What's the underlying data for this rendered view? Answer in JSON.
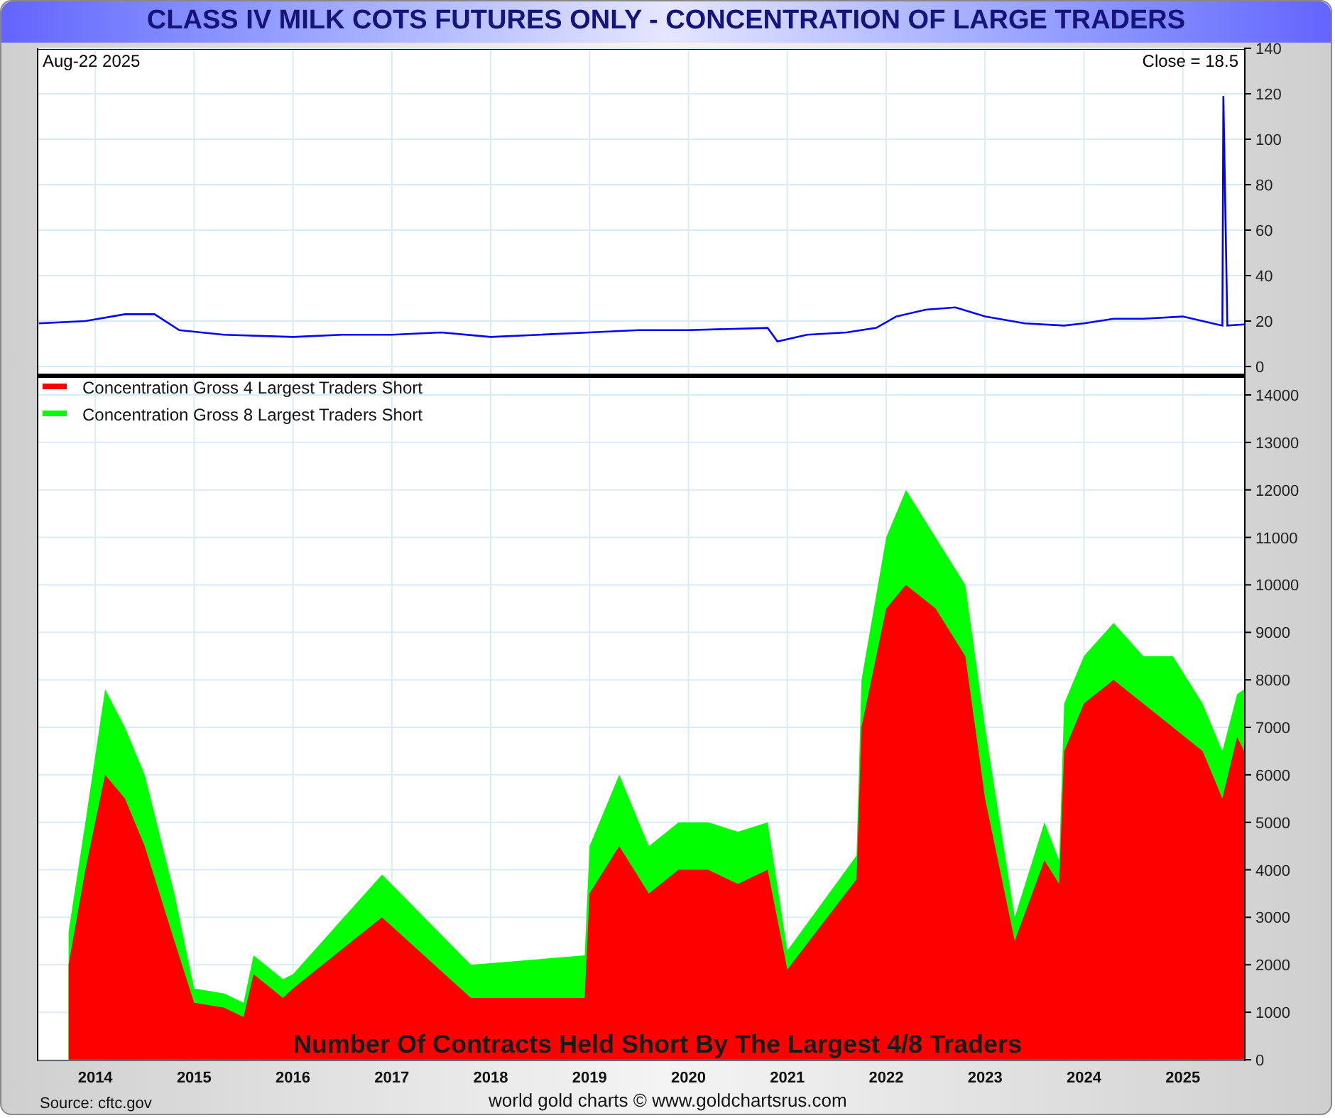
{
  "title": "CLASS IV MILK COTS FUTURES ONLY - CONCENTRATION OF LARGE TRADERS",
  "top_chart": {
    "date_label": "Aug-22  2025",
    "close_label": "Close = 18.5",
    "chart_data": {
      "type": "line",
      "grid": true,
      "xlim": [
        2013.41,
        2025.62
      ],
      "ylim": [
        0,
        140
      ],
      "yticks": [
        0,
        20,
        40,
        60,
        80,
        100,
        120,
        140
      ],
      "x": [
        2013.43,
        2013.9,
        2014.3,
        2014.6,
        2014.85,
        2015.3,
        2016.0,
        2016.5,
        2017.0,
        2017.5,
        2018.0,
        2018.5,
        2019.0,
        2019.5,
        2020.0,
        2020.8,
        2020.9,
        2021.2,
        2021.6,
        2021.9,
        2022.1,
        2022.4,
        2022.7,
        2023.0,
        2023.4,
        2023.8,
        2024.0,
        2024.3,
        2024.6,
        2025.0,
        2025.3,
        2025.4,
        2025.41,
        2025.45,
        2025.62
      ],
      "series": [
        {
          "color": "#0000ff",
          "values": [
            19,
            20,
            23,
            23,
            16,
            14,
            13,
            14,
            14,
            15,
            13,
            14,
            15,
            16,
            16,
            17,
            11,
            14,
            15,
            17,
            22,
            25,
            26,
            22,
            19,
            18,
            19,
            21,
            21,
            22,
            19,
            18,
            119,
            18,
            18.5
          ]
        }
      ]
    }
  },
  "bottom_chart": {
    "chart_data": {
      "type": "area",
      "grid": true,
      "legend": true,
      "xlim": [
        2013.41,
        2025.62
      ],
      "ylim": [
        0,
        14000
      ],
      "yticks": [
        0,
        1000,
        2000,
        3000,
        4000,
        5000,
        6000,
        7000,
        8000,
        9000,
        10000,
        11000,
        12000,
        13000,
        14000
      ],
      "xticks": [
        {
          "value": 2014,
          "label": "2014"
        },
        {
          "value": 2015,
          "label": "2015"
        },
        {
          "value": 2016,
          "label": "2016"
        },
        {
          "value": 2017,
          "label": "2017"
        },
        {
          "value": 2018,
          "label": "2018"
        },
        {
          "value": 2019,
          "label": "2019"
        },
        {
          "value": 2020,
          "label": "2020"
        },
        {
          "value": 2021,
          "label": "2021"
        },
        {
          "value": 2022,
          "label": "2022"
        },
        {
          "value": 2023,
          "label": "2023"
        },
        {
          "value": 2024,
          "label": "2024"
        },
        {
          "value": 2025,
          "label": "2025"
        }
      ],
      "x": [
        2013.73,
        2013.9,
        2014.1,
        2014.3,
        2014.5,
        2014.8,
        2015.0,
        2015.3,
        2015.5,
        2015.6,
        2015.9,
        2016.0,
        2016.9,
        2017.8,
        2018.95,
        2019.0,
        2019.3,
        2019.6,
        2019.9,
        2020.2,
        2020.5,
        2020.8,
        2021.0,
        2021.7,
        2021.75,
        2022.0,
        2022.2,
        2022.5,
        2022.8,
        2023.0,
        2023.3,
        2023.6,
        2023.75,
        2023.8,
        2024.0,
        2024.3,
        2024.6,
        2024.9,
        2025.2,
        2025.4,
        2025.55,
        2025.62
      ],
      "series": [
        {
          "name": "Concentration Gross 8 Largest Traders Short",
          "color": "#00ff00",
          "values": [
            2700,
            5000,
            7800,
            7000,
            6000,
            3500,
            1500,
            1400,
            1200,
            2200,
            1700,
            1800,
            3900,
            2000,
            2200,
            4500,
            6000,
            4500,
            5000,
            5000,
            4800,
            5000,
            2300,
            4300,
            8000,
            11000,
            12000,
            11000,
            10000,
            7000,
            3000,
            5000,
            4200,
            7500,
            8500,
            9200,
            8500,
            8500,
            7500,
            6500,
            7700,
            7800
          ]
        },
        {
          "name": "Concentration Gross 4 Largest Traders Short",
          "color": "#ff0000",
          "values": [
            2000,
            4000,
            6000,
            5500,
            4500,
            2500,
            1200,
            1100,
            900,
            1800,
            1300,
            1500,
            3000,
            1300,
            1300,
            3500,
            4500,
            3500,
            4000,
            4000,
            3700,
            4000,
            1900,
            3800,
            7000,
            9500,
            10000,
            9500,
            8500,
            5500,
            2500,
            4200,
            3700,
            6500,
            7500,
            8000,
            7500,
            7000,
            6500,
            5500,
            6800,
            6500
          ]
        }
      ],
      "annotations": [
        "Number Of Contracts Held Short By The Largest 4/8 Traders"
      ]
    }
  },
  "footer": {
    "source": "Source: cftc.gov",
    "credit": "world gold charts © www.goldchartsrus.com"
  }
}
